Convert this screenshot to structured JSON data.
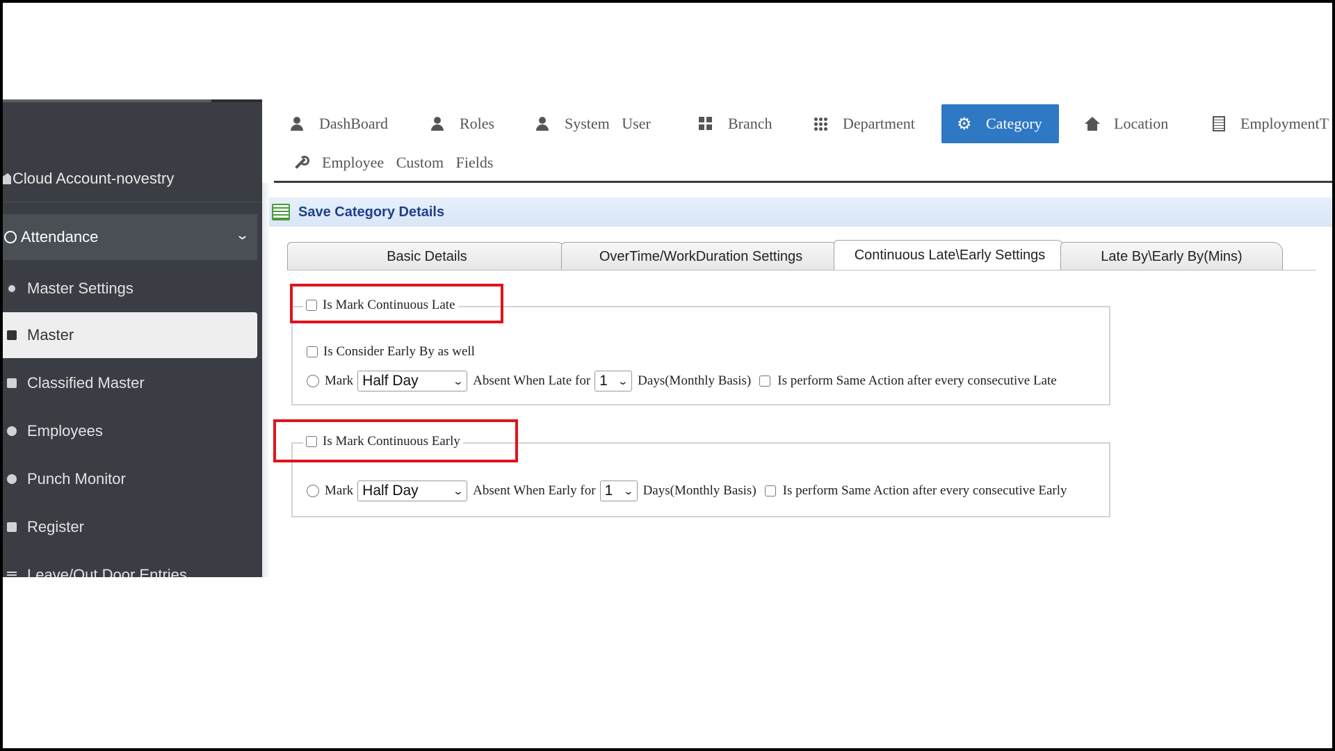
{
  "sidebar": {
    "account": "Cloud Account-novestry",
    "section": "Attendance",
    "items": [
      {
        "label": "Master Settings",
        "icon": "gear-icon"
      },
      {
        "label": "Master",
        "icon": "square-icon",
        "active": true
      },
      {
        "label": "Classified Master",
        "icon": "square-icon"
      },
      {
        "label": "Employees",
        "icon": "users-icon"
      },
      {
        "label": "Punch Monitor",
        "icon": "circle-icon"
      },
      {
        "label": "Register",
        "icon": "square-icon"
      },
      {
        "label": "Leave/Out Door Entries",
        "icon": "list-icon"
      }
    ]
  },
  "nav": {
    "items": [
      {
        "label": "DashBoard",
        "icon": "user-icon"
      },
      {
        "label": "Roles",
        "icon": "user-icon"
      },
      {
        "label": "System User",
        "icon": "user-icon"
      },
      {
        "label": "Branch",
        "icon": "grid-icon"
      },
      {
        "label": "Department",
        "icon": "apps-icon"
      },
      {
        "label": "Category",
        "icon": "gear-icon",
        "active": true
      },
      {
        "label": "Location",
        "icon": "home-icon"
      },
      {
        "label": "EmploymentT",
        "icon": "document-icon"
      },
      {
        "label": "Employee Custom Fields",
        "icon": "wrench-icon"
      }
    ],
    "active_color": "#2f78c4"
  },
  "panel": {
    "title": "Save Category Details"
  },
  "tabs": [
    {
      "label": "Basic Details"
    },
    {
      "label": "OverTime/WorkDuration Settings"
    },
    {
      "label": "Continuous Late\\Early Settings",
      "active": true
    },
    {
      "label": "Late By\\Early By(Mins)"
    }
  ],
  "late_section": {
    "legend": "Is Mark Continuous Late",
    "consider_early": "Is Consider Early By as well",
    "mark_label": "Mark",
    "mark_value": "Half Day",
    "absent_label": "Absent When Late for",
    "days_value": "1",
    "days_label": "Days(Monthly Basis)",
    "repeat_label": "Is perform Same Action after every consecutive Late"
  },
  "early_section": {
    "legend": "Is Mark Continuous Early",
    "mark_label": "Mark",
    "mark_value": "Half Day",
    "absent_label": "Absent When Early for",
    "days_value": "1",
    "days_label": "Days(Monthly Basis)",
    "repeat_label": "Is perform Same Action after every consecutive Early"
  },
  "highlight_color": "#e0141b"
}
